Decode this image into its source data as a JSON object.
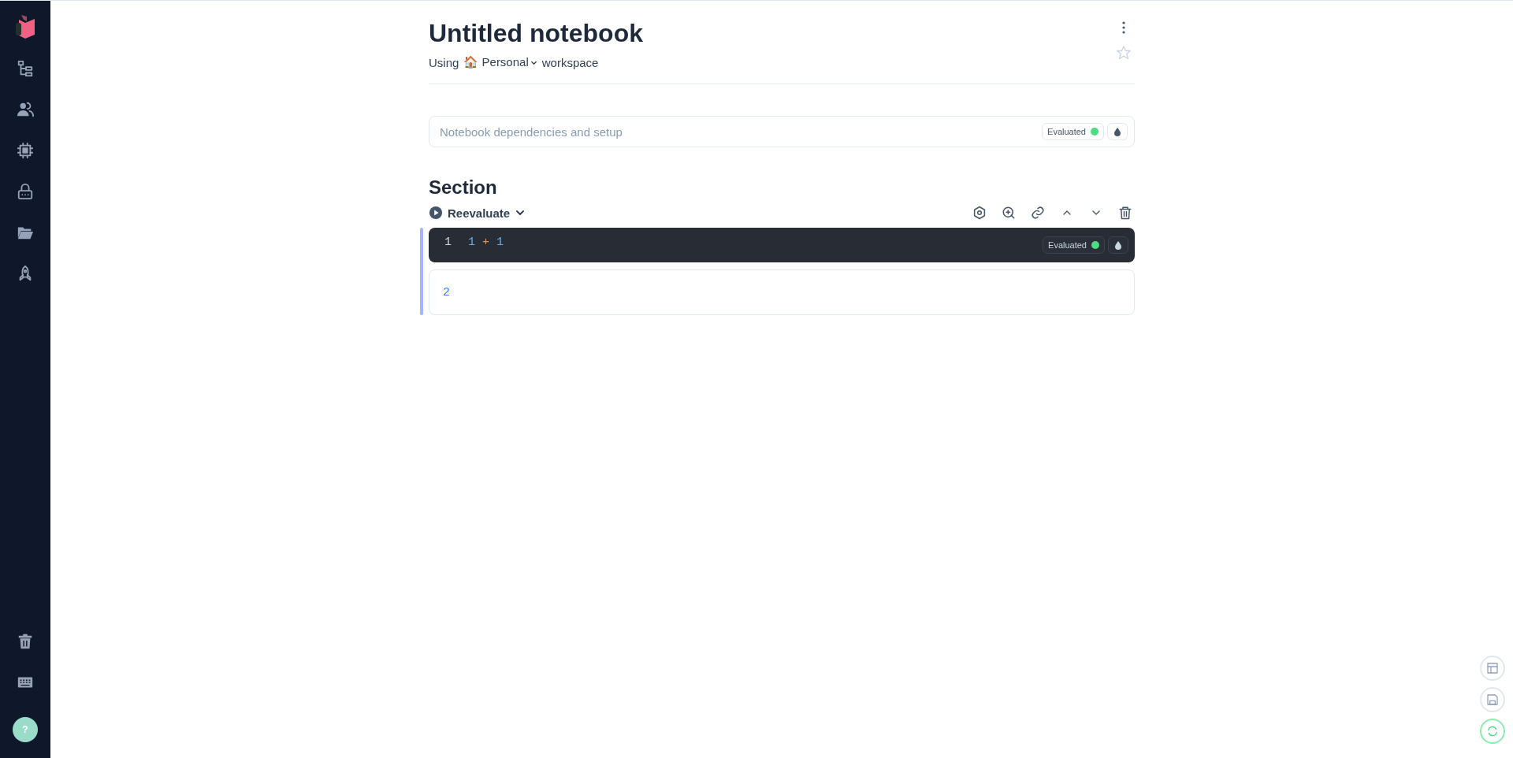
{
  "sidebar": {
    "items": [
      {
        "kind": "tree"
      },
      {
        "kind": "people"
      },
      {
        "kind": "chip"
      },
      {
        "kind": "lock"
      },
      {
        "kind": "folder"
      },
      {
        "kind": "rocket"
      }
    ],
    "bottom_items": [
      {
        "kind": "trash"
      },
      {
        "kind": "keyboard"
      }
    ],
    "help": "?"
  },
  "notebook": {
    "title": "Untitled notebook",
    "workspace_prefix": "Using",
    "workspace_emoji": "🏠",
    "workspace_name": "Personal",
    "workspace_suffix": "workspace",
    "starred": false
  },
  "setup": {
    "label": "Notebook dependencies and setup",
    "status": "Evaluated"
  },
  "section": {
    "title": "Section",
    "run_button": "Reevaluate",
    "cell": {
      "line_number": "1",
      "tokens": [
        {
          "text": "1",
          "kind": "number"
        },
        {
          "text": "+",
          "kind": "operator"
        },
        {
          "text": "1",
          "kind": "number"
        }
      ],
      "status": "Evaluated",
      "output": "2"
    }
  },
  "floating_buttons": [
    {
      "kind": "layout"
    },
    {
      "kind": "save"
    },
    {
      "kind": "sync"
    }
  ]
}
